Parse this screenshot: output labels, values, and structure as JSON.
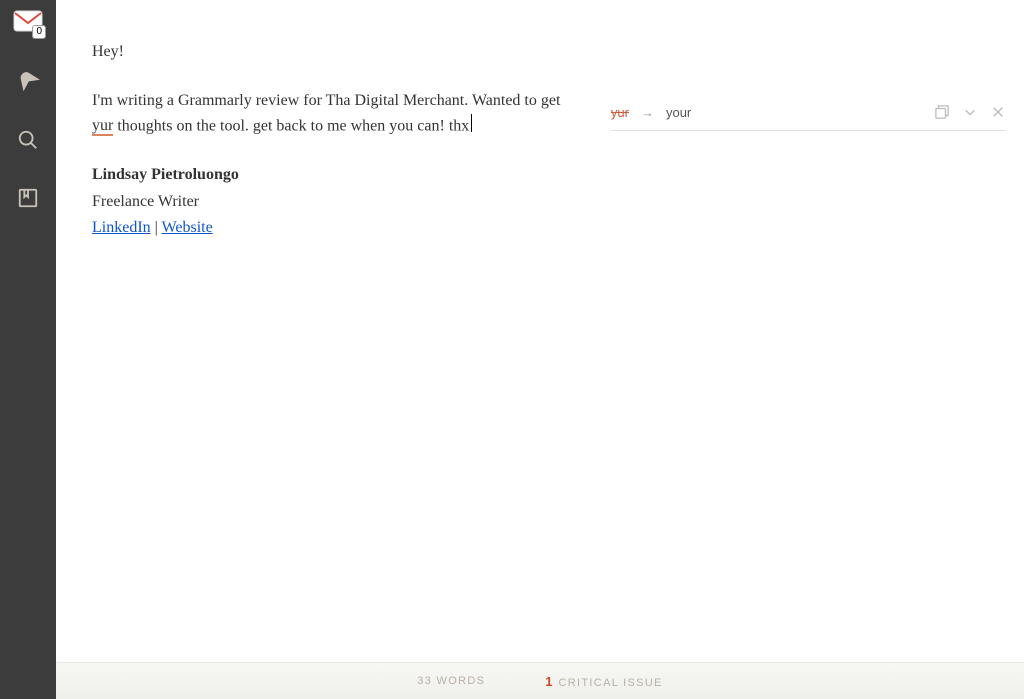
{
  "rail": {
    "mail_count": "0"
  },
  "editor": {
    "greeting": "Hey!",
    "para_a": "I'm writing a Grammarly review for Tha Digital Merchant. Wanted to get ",
    "flagged": "yur",
    "para_b": " thoughts on the tool. get back to me when you can! thx",
    "sig_name": "Lindsay Pietroluongo",
    "sig_role": "Freelance Writer",
    "link_linkedin": "LinkedIn",
    "link_sep": " | ",
    "link_website": "Website"
  },
  "suggestion": {
    "from": "yur",
    "arrow": "→",
    "to": "your"
  },
  "footer": {
    "word_count": "33 WORDS",
    "issue_count": "1",
    "issue_label": "CRITICAL ISSUE"
  }
}
